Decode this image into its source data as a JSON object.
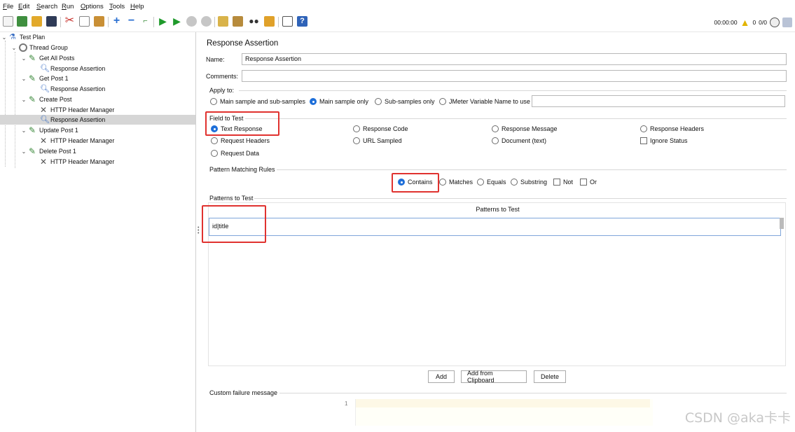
{
  "menubar": {
    "items": [
      {
        "accel": "F",
        "rest": "ile"
      },
      {
        "accel": "E",
        "rest": "dit"
      },
      {
        "accel": "S",
        "rest": "earch"
      },
      {
        "accel": "R",
        "rest": "un"
      },
      {
        "accel": "O",
        "rest": "ptions"
      },
      {
        "accel": "T",
        "rest": "ools"
      },
      {
        "accel": "H",
        "rest": "elp"
      }
    ]
  },
  "toolbar": {
    "icons": [
      "new-icon",
      "templates-icon",
      "open-icon",
      "save-icon",
      "cut-icon",
      "copy-icon",
      "paste-icon",
      "expand-icon",
      "collapse-icon",
      "toggle-icon",
      "start-icon",
      "start-no-pause-icon",
      "stop-icon",
      "shutdown-icon",
      "clear-icon",
      "clear-all-icon",
      "search-icon",
      "reset-search-icon",
      "function-helper-icon",
      "help-icon"
    ],
    "status": {
      "timer": "00:00:00",
      "warnings": "0",
      "threads": "0/0"
    }
  },
  "tree": {
    "items": [
      {
        "label": "Test Plan",
        "icon": "test-plan-icon",
        "twisty": "v"
      },
      {
        "label": "Thread Group",
        "icon": "thread-group-icon",
        "twisty": "v"
      },
      {
        "label": "Get All Posts",
        "icon": "http-sampler-icon",
        "twisty": "v"
      },
      {
        "label": "Response Assertion",
        "icon": "assertion-icon",
        "twisty": ""
      },
      {
        "label": "Get Post 1",
        "icon": "http-sampler-icon",
        "twisty": "v"
      },
      {
        "label": "Response Assertion",
        "icon": "assertion-icon",
        "twisty": ""
      },
      {
        "label": "Create Post",
        "icon": "http-sampler-icon",
        "twisty": "v"
      },
      {
        "label": "HTTP Header Manager",
        "icon": "header-manager-icon",
        "twisty": ""
      },
      {
        "label": "Response Assertion",
        "icon": "assertion-icon",
        "twisty": "",
        "selected": true
      },
      {
        "label": "Update Post 1",
        "icon": "http-sampler-icon",
        "twisty": "v"
      },
      {
        "label": "HTTP Header Manager",
        "icon": "header-manager-icon",
        "twisty": ""
      },
      {
        "label": "Delete Post 1",
        "icon": "http-sampler-icon",
        "twisty": "v"
      },
      {
        "label": "HTTP Header Manager",
        "icon": "header-manager-icon",
        "twisty": ""
      }
    ]
  },
  "panel": {
    "title": "Response Assertion",
    "name_label": "Name:",
    "name_value": "Response Assertion",
    "comments_label": "Comments:",
    "comments_value": "",
    "apply_to": {
      "label": "Apply to:",
      "options": [
        {
          "label": "Main sample and sub-samples",
          "selected": false
        },
        {
          "label": "Main sample only",
          "selected": true
        },
        {
          "label": "Sub-samples only",
          "selected": false
        },
        {
          "label": "JMeter Variable Name to use",
          "selected": false
        }
      ],
      "variable_value": ""
    },
    "field_to_test": {
      "label": "Field to Test",
      "options": [
        {
          "label": "Text Response",
          "selected": true,
          "kind": "radio"
        },
        {
          "label": "Response Code",
          "selected": false,
          "kind": "radio"
        },
        {
          "label": "Response Message",
          "selected": false,
          "kind": "radio"
        },
        {
          "label": "Response Headers",
          "selected": false,
          "kind": "radio"
        },
        {
          "label": "Request Headers",
          "selected": false,
          "kind": "radio"
        },
        {
          "label": "URL Sampled",
          "selected": false,
          "kind": "radio"
        },
        {
          "label": "Document (text)",
          "selected": false,
          "kind": "radio"
        },
        {
          "label": "Ignore Status",
          "selected": false,
          "kind": "check"
        },
        {
          "label": "Request Data",
          "selected": false,
          "kind": "radio"
        }
      ]
    },
    "pattern_rules": {
      "label": "Pattern Matching Rules",
      "options": [
        {
          "label": "Contains",
          "selected": true,
          "kind": "radio"
        },
        {
          "label": "Matches",
          "selected": false,
          "kind": "radio"
        },
        {
          "label": "Equals",
          "selected": false,
          "kind": "radio"
        },
        {
          "label": "Substring",
          "selected": false,
          "kind": "radio"
        },
        {
          "label": "Not",
          "selected": false,
          "kind": "check"
        },
        {
          "label": "Or",
          "selected": false,
          "kind": "check"
        }
      ]
    },
    "patterns": {
      "label": "Patterns to Test",
      "column_header": "Patterns to Test",
      "rows": [
        "id|title"
      ]
    },
    "buttons": {
      "add": "Add",
      "add_clipboard": "Add from Clipboard",
      "delete": "Delete"
    },
    "failure": {
      "label": "Custom failure message",
      "line_number": "1",
      "value": ""
    }
  },
  "watermark": "CSDN @aka卡卡",
  "colors": {
    "accent": "#1e6fd9",
    "highlight_box": "#e0322f",
    "selection": "#d6d6d6"
  }
}
